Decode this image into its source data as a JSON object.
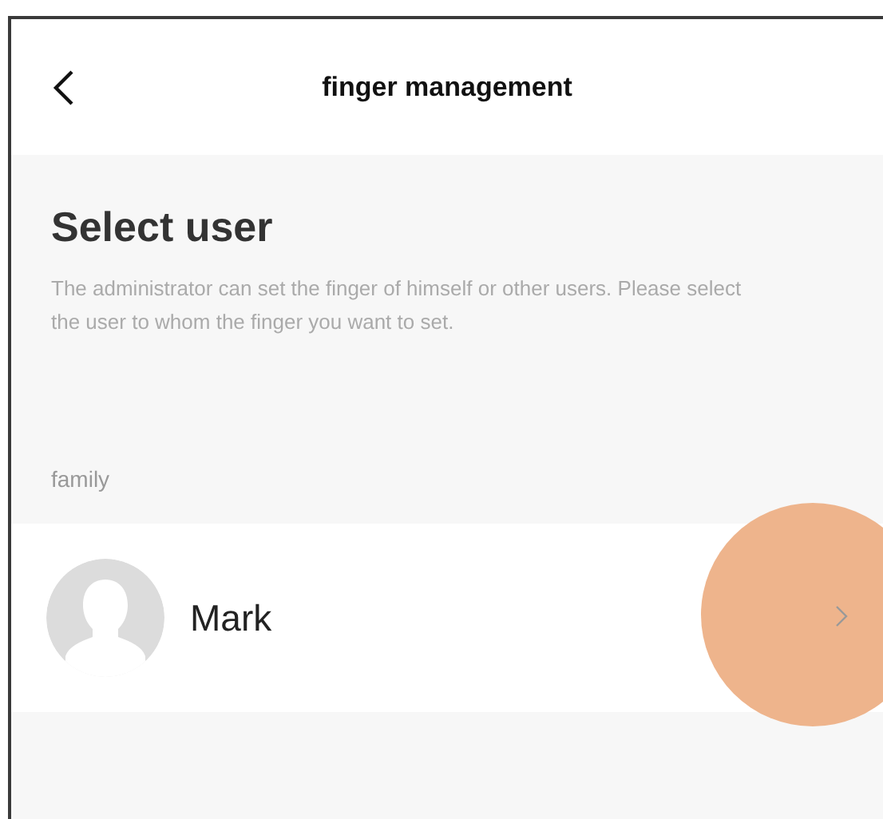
{
  "header": {
    "title": "finger management"
  },
  "heading": "Select user",
  "description": "The administrator can set the finger of himself or other users. Please select the user to whom the finger you want to set.",
  "groups": [
    {
      "label": "family",
      "users": [
        {
          "name": "Mark",
          "touched": true
        }
      ]
    }
  ]
}
